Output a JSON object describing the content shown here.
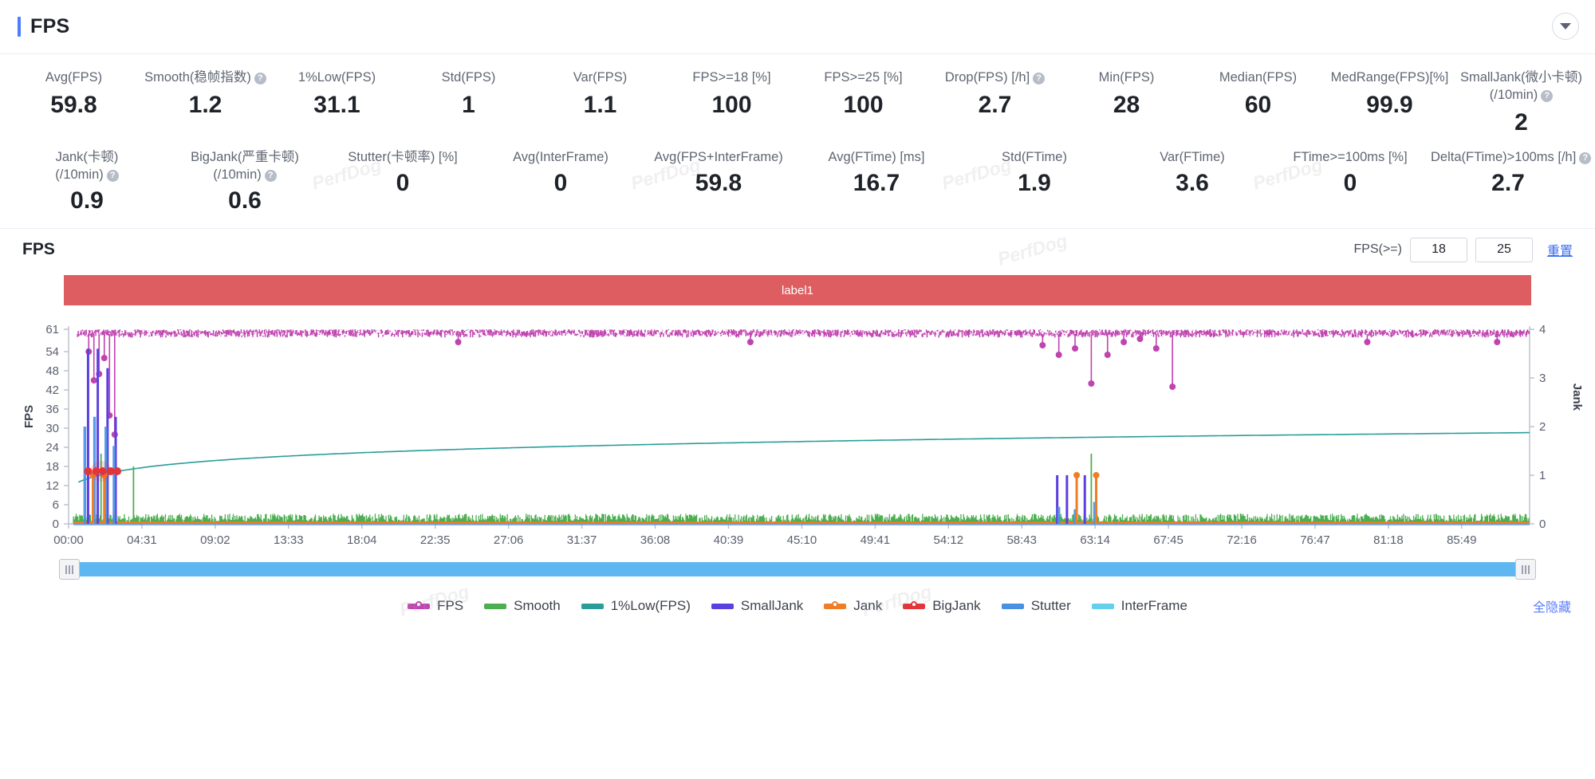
{
  "header": {
    "title": "FPS",
    "collapse_icon": "chevron-down-icon",
    "accent": "#4a7dff"
  },
  "metrics": {
    "row1": [
      {
        "label": "Avg(FPS)",
        "value": "59.8",
        "help": false
      },
      {
        "label": "Smooth(稳帧指数)",
        "value": "1.2",
        "help": true
      },
      {
        "label": "1%Low(FPS)",
        "value": "31.1",
        "help": false
      },
      {
        "label": "Std(FPS)",
        "value": "1",
        "help": false
      },
      {
        "label": "Var(FPS)",
        "value": "1.1",
        "help": false
      },
      {
        "label": "FPS>=18 [%]",
        "value": "100",
        "help": false
      },
      {
        "label": "FPS>=25 [%]",
        "value": "100",
        "help": false
      },
      {
        "label": "Drop(FPS) [/h]",
        "value": "2.7",
        "help": true
      },
      {
        "label": "Min(FPS)",
        "value": "28",
        "help": false
      },
      {
        "label": "Median(FPS)",
        "value": "60",
        "help": false
      },
      {
        "label": "MedRange(FPS)[%]",
        "value": "99.9",
        "help": false
      },
      {
        "label": "SmallJank(微小卡顿)",
        "label2": "(/10min)",
        "value": "2",
        "help": true
      }
    ],
    "row2": [
      {
        "label": "Jank(卡顿)",
        "label2": "(/10min)",
        "value": "0.9",
        "help": true
      },
      {
        "label": "BigJank(严重卡顿)",
        "label2": "(/10min)",
        "value": "0.6",
        "help": true
      },
      {
        "label": "Stutter(卡顿率) [%]",
        "value": "0",
        "help": false
      },
      {
        "label": "Avg(InterFrame)",
        "value": "0",
        "help": false
      },
      {
        "label": "Avg(FPS+InterFrame)",
        "value": "59.8",
        "help": false
      },
      {
        "label": "Avg(FTime) [ms]",
        "value": "16.7",
        "help": false
      },
      {
        "label": "Std(FTime)",
        "value": "1.9",
        "help": false
      },
      {
        "label": "Var(FTime)",
        "value": "3.6",
        "help": false
      },
      {
        "label": "FTime>=100ms [%]",
        "value": "0",
        "help": false
      },
      {
        "label": "Delta(FTime)>100ms [/h]",
        "value": "2.7",
        "help": true
      }
    ]
  },
  "chart_panel": {
    "title": "FPS",
    "threshold_label": "FPS(>=)",
    "threshold_low": "18",
    "threshold_high": "25",
    "reset_label": "重置",
    "band_label": "label1",
    "band_color": "#dd5d61",
    "hide_all_label": "全隐藏"
  },
  "chart_data": {
    "type": "line",
    "title": "FPS",
    "xlabel": "",
    "ylabel": "FPS",
    "y2label": "Jank",
    "ylim": [
      0,
      61
    ],
    "y2lim": [
      0,
      4
    ],
    "grid": false,
    "legend_position": "bottom",
    "yticks": [
      0,
      6,
      12,
      18,
      24,
      30,
      36,
      42,
      48,
      54,
      61
    ],
    "y2ticks": [
      0,
      1,
      2,
      3,
      4
    ],
    "xticks": [
      "00:00",
      "04:31",
      "09:02",
      "13:33",
      "18:04",
      "22:35",
      "27:06",
      "31:37",
      "36:08",
      "40:39",
      "45:10",
      "49:41",
      "54:12",
      "58:43",
      "63:14",
      "67:45",
      "72:16",
      "76:47",
      "81:18",
      "85:49"
    ],
    "series": [
      {
        "name": "FPS",
        "color": "#c043b0",
        "axis": "left",
        "baseline": 59.8,
        "noise": 1.2,
        "dips": [
          [
            2,
            54
          ],
          [
            3,
            45
          ],
          [
            4,
            47
          ],
          [
            5,
            52
          ],
          [
            6,
            34
          ],
          [
            7,
            28
          ],
          [
            60,
            56
          ],
          [
            61,
            53
          ],
          [
            62,
            55
          ],
          [
            63,
            44
          ],
          [
            64,
            53
          ],
          [
            65,
            57
          ],
          [
            66,
            58
          ],
          [
            67,
            55
          ],
          [
            68,
            43
          ],
          [
            24,
            57
          ],
          [
            42,
            57
          ],
          [
            80,
            57
          ],
          [
            88,
            57
          ]
        ]
      },
      {
        "name": "Smooth",
        "color": "#4caf50",
        "axis": "left",
        "baseline": 1.5,
        "noise": 1.2,
        "spikes": [
          [
            2,
            22
          ],
          [
            4,
            18
          ],
          [
            63,
            22
          ]
        ]
      },
      {
        "name": "1%Low(FPS)",
        "color": "#2a9d9a",
        "axis": "left",
        "curve": "log",
        "start": 11.5,
        "end": 28.6
      },
      {
        "name": "SmallJank",
        "color": "#5b3fe0",
        "axis": "right",
        "baseline": 0,
        "spikes": [
          [
            1.2,
            3.6
          ],
          [
            1.8,
            3.6
          ],
          [
            2.4,
            3.2
          ],
          [
            2.9,
            2.2
          ],
          [
            60.9,
            1.0
          ],
          [
            61.5,
            1.0
          ],
          [
            62.6,
            1.0
          ]
        ]
      },
      {
        "name": "Jank",
        "color": "#f07c26",
        "axis": "right",
        "baseline": 0,
        "spikes": [
          [
            1.5,
            1.0
          ],
          [
            2.2,
            1.0
          ],
          [
            62.1,
            1.0
          ],
          [
            63.3,
            1.0
          ]
        ]
      },
      {
        "name": "BigJank",
        "color": "#e2353a",
        "axis": "left",
        "baseline": 0,
        "markers": [
          [
            1.2,
            16.5
          ],
          [
            1.7,
            16.5
          ],
          [
            2.1,
            16.5
          ],
          [
            2.6,
            16.5
          ],
          [
            3.0,
            16.5
          ]
        ]
      },
      {
        "name": "Stutter",
        "color": "#4a90e2",
        "axis": "right",
        "baseline": 0,
        "spikes": [
          [
            1.0,
            2.0
          ],
          [
            1.6,
            2.2
          ],
          [
            2.3,
            2.0
          ],
          [
            2.8,
            1.6
          ],
          [
            61.0,
            0.35
          ],
          [
            62.0,
            0.3
          ],
          [
            63.2,
            0.45
          ]
        ]
      },
      {
        "name": "InterFrame",
        "color": "#62d0ec",
        "axis": "right",
        "baseline": 0,
        "spikes": []
      }
    ]
  },
  "legend": [
    {
      "label": "FPS",
      "color": "#c043b0",
      "dot": true
    },
    {
      "label": "Smooth",
      "color": "#4caf50",
      "dot": false
    },
    {
      "label": "1%Low(FPS)",
      "color": "#2a9d9a",
      "dot": false
    },
    {
      "label": "SmallJank",
      "color": "#5b3fe0",
      "dot": false
    },
    {
      "label": "Jank",
      "color": "#f07c26",
      "dot": true
    },
    {
      "label": "BigJank",
      "color": "#e2353a",
      "dot": true
    },
    {
      "label": "Stutter",
      "color": "#4a90e2",
      "dot": false
    },
    {
      "label": "InterFrame",
      "color": "#62d0ec",
      "dot": false
    }
  ],
  "watermarks": [
    "PerfDog",
    "PerfDog",
    "PerfDog",
    "PerfDog",
    "PerfDog",
    "PerfDog",
    "PerfDog"
  ]
}
